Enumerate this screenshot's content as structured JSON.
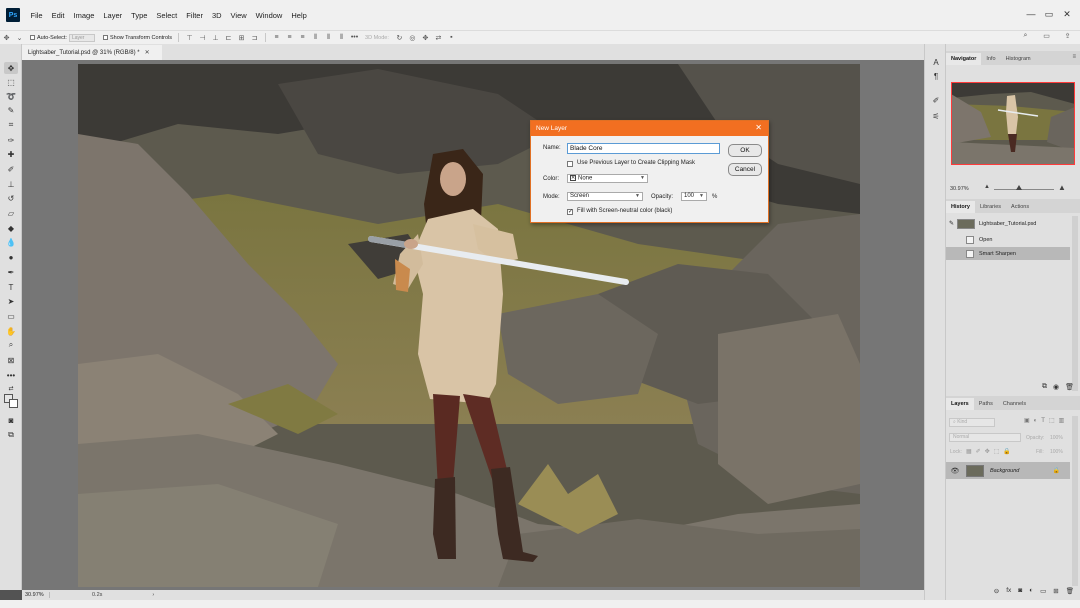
{
  "app": {
    "logo": "Ps"
  },
  "menu": [
    "File",
    "Edit",
    "Image",
    "Layer",
    "Type",
    "Select",
    "Filter",
    "3D",
    "View",
    "Window",
    "Help"
  ],
  "window_controls": {
    "minimize": "—",
    "restore": "▭",
    "close": "✕"
  },
  "options_bar": {
    "auto_select_label": "Auto-Select:",
    "auto_select_value": "Layer",
    "transform_label": "Show Transform Controls",
    "mode_label": "3D Mode:",
    "more": "•••"
  },
  "document": {
    "tab_title": "Lightsaber_Tutorial.psd @ 31% (RGB/8) *",
    "tab_close": "✕"
  },
  "status_bar": {
    "zoom": "30.97%",
    "doc_info": "0.2s",
    "arrow": "›"
  },
  "panels": {
    "navigator": {
      "tabs": [
        "Navigator",
        "Info",
        "Histogram"
      ],
      "zoom": "30.97%"
    },
    "history": {
      "tabs": [
        "History",
        "Libraries",
        "Actions"
      ],
      "snapshot": "Lightsaber_Tutorial.psd",
      "items": [
        "Open",
        "Smart Sharpen"
      ]
    },
    "layers": {
      "tabs": [
        "Layers",
        "Paths",
        "Channels"
      ],
      "kind_placeholder": "Kind",
      "blend_mode": "Normal",
      "opacity_label": "Opacity:",
      "opacity_value": "100%",
      "lock_label": "Lock:",
      "fill_label": "Fill:",
      "fill_value": "100%",
      "layer_name": "Background",
      "menu_icon": "≡"
    }
  },
  "dialog": {
    "title": "New Layer",
    "close": "✕",
    "name_label": "Name:",
    "name_value": "Blade Core",
    "clip_label": "Use Previous Layer to Create Clipping Mask",
    "clip_checked": false,
    "color_label": "Color:",
    "color_value": "None",
    "mode_label": "Mode:",
    "mode_value": "Screen",
    "opacity_label": "Opacity:",
    "opacity_value": "100",
    "percent": "%",
    "fill_label": "Fill with Screen-neutral color (black)",
    "fill_checked": true,
    "ok_label": "OK",
    "cancel_label": "Cancel"
  },
  "colors": {
    "dialog_titlebar": "#f26f21",
    "navigator_frame": "#ff3b3b",
    "ui_light": "#f0f0f0",
    "ui_panel": "#e0e0e0"
  }
}
